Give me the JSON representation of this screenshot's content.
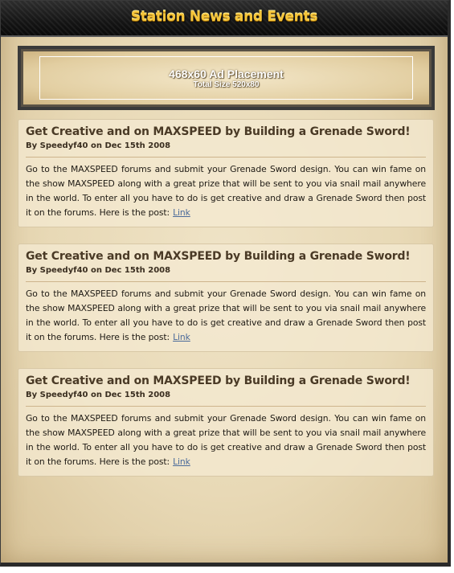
{
  "header": {
    "title": "Station News and Events"
  },
  "ad": {
    "label": "468x60 Ad Placement",
    "sublabel": "Total Size 520x80"
  },
  "posts": [
    {
      "title": "Get Creative and on MAXSPEED by Building a Grenade Sword!",
      "meta": "By Speedyf40 on Dec 15th 2008",
      "body": "Go to the MAXSPEED forums and submit your Grenade Sword design. You can win fame on the show MAXSPEED along with a great prize that will be sent to you via snail mail anywhere in the world. To enter all you have to do is get creative and draw a Grenade Sword then post it on the forums. Here is the post:",
      "link": "Link"
    },
    {
      "title": "Get Creative and on MAXSPEED by Building a Grenade Sword!",
      "meta": "By Speedyf40 on Dec 15th 2008",
      "body": "Go to the MAXSPEED forums and submit your Grenade Sword design. You can win fame on the show MAXSPEED along with a great prize that will be sent to you via snail mail anywhere in the world. To enter all you have to do is get creative and draw a Grenade Sword then post it on the forums. Here is the post:",
      "link": "Link"
    },
    {
      "title": "Get Creative and on MAXSPEED by Building a Grenade Sword!",
      "meta": "By Speedyf40 on Dec 15th 2008",
      "body": "Go to the MAXSPEED forums and submit your Grenade Sword design. You can win fame on the show MAXSPEED along with a great prize that will be sent to you via snail mail anywhere in the world. To enter all you have to do is get creative and draw a Grenade Sword then post it on the forums. Here is the post:",
      "link": "Link"
    }
  ],
  "colors": {
    "title_gold": "#f5c53a",
    "link": "#4a6a9a",
    "parchment": "#e8d9b6"
  }
}
